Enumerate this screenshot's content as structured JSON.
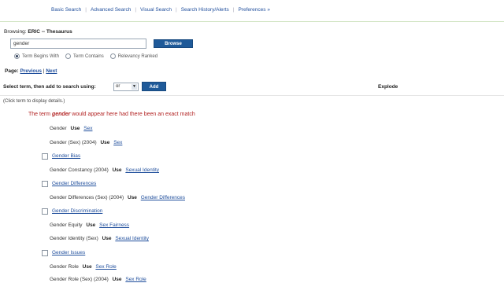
{
  "nav": {
    "basic_search": "Basic Search",
    "advanced_search": "Advanced Search",
    "visual_search": "Visual Search",
    "search_history": "Search History/Alerts",
    "preferences": "Preferences »"
  },
  "browse": {
    "label": "Browsing:",
    "source": "ERIC -- Thesaurus",
    "input_value": "gender",
    "button": "Browse"
  },
  "radios": [
    {
      "label": "Term Begins With",
      "checked": true
    },
    {
      "label": "Term Contains",
      "checked": false
    },
    {
      "label": "Relevancy Ranked",
      "checked": false
    }
  ],
  "pager": {
    "label": "Page:",
    "previous": "Previous",
    "separator": "|",
    "next": "Next"
  },
  "add": {
    "label": "Select term, then add to search using:",
    "operator": "or",
    "button": "Add",
    "explode_header": "Explode"
  },
  "hint": "(Click term to display details.)",
  "no_match": {
    "prefix": "The term",
    "term": "gender",
    "suffix": "would appear here had there been an exact match"
  },
  "terms": [
    {
      "term": "Gender",
      "use": "Use",
      "target": "Sex"
    },
    {
      "term": "Gender (Sex) (2004)",
      "use": "Use",
      "target": "Sex"
    },
    {
      "term": "Gender Bias",
      "checkbox": true
    },
    {
      "term": "Gender Constancy (2004)",
      "use": "Use",
      "target": "Sexual Identity"
    },
    {
      "term": "Gender Differences",
      "checkbox": true
    },
    {
      "term": "Gender Differences (Sex) (2004)",
      "use": "Use",
      "target": "Gender Differences"
    },
    {
      "term": "Gender Discrimination",
      "checkbox": true
    },
    {
      "term": "Gender Equity",
      "use": "Use",
      "target": "Sex Fairness"
    },
    {
      "term": "Gender Identity (Sex)",
      "use": "Use",
      "target": "Sexual Identity"
    },
    {
      "term": "Gender Issues",
      "checkbox": true
    },
    {
      "term": "Gender Role",
      "use": "Use",
      "target": "Sex Role"
    },
    {
      "term": "Gender Role (Sex) (2004)",
      "use": "Use",
      "target": "Sex Role"
    }
  ]
}
